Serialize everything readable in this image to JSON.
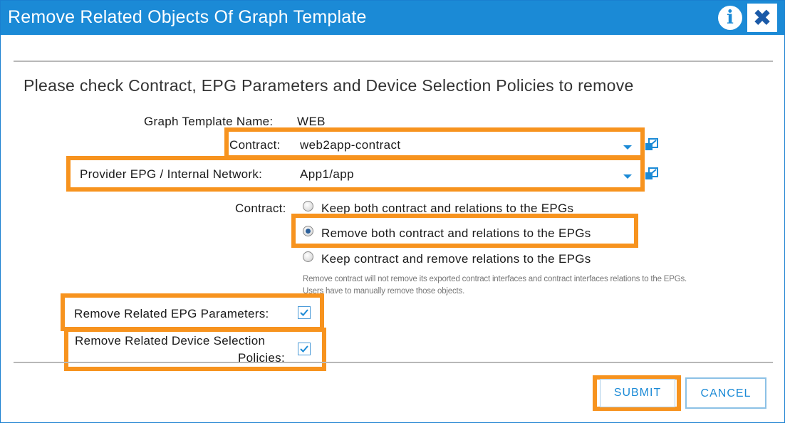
{
  "dialog": {
    "title": "Remove Related Objects Of Graph Template",
    "info_glyph": "i",
    "close_glyph": "✖",
    "heading": "Please check Contract, EPG Parameters and Device Selection Policies to remove"
  },
  "form": {
    "graph_template_label": "Graph Template Name:",
    "graph_template_value": "WEB",
    "contract_label": "Contract:",
    "contract_value": "web2app-contract",
    "provider_label": "Provider EPG / Internal Network:",
    "provider_value": "App1/app",
    "contract_option_label": "Contract:",
    "radio_options": [
      "Keep both contract and relations to the EPGs",
      "Remove both contract and relations to the EPGs",
      "Keep contract and remove relations to the EPGs"
    ],
    "selected_radio_index": 1,
    "note": "Remove contract will not remove its exported contract interfaces and contract interfaces relations to the EPGs. Users have to manually remove those objects.",
    "epg_params_label": "Remove Related EPG Parameters:",
    "epg_params_checked": true,
    "device_policies_label_line1": "Remove Related Device Selection",
    "device_policies_label_line2": "Policies:",
    "device_policies_checked": true
  },
  "buttons": {
    "submit": "SUBMIT",
    "cancel": "CANCEL"
  },
  "colors": {
    "titlebar": "#1b8ad6",
    "highlight": "#f7931e",
    "accent": "#1b8ad6"
  },
  "icons": [
    "info-icon",
    "close-icon",
    "external-link-icon",
    "dropdown-arrow-icon",
    "checkmark-icon"
  ]
}
